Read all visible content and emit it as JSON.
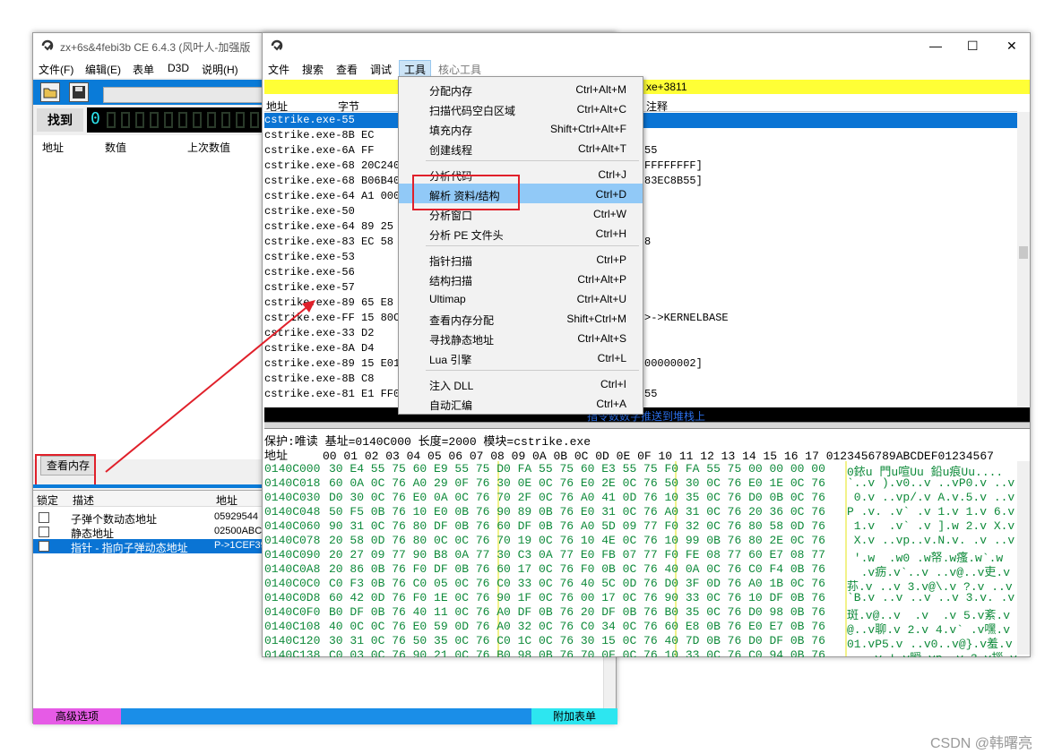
{
  "main_window": {
    "title": "zx+6s&4febi3b  CE 6.4.3 (风叶人-加强版",
    "menu": [
      "文件(F)",
      "编辑(E)",
      "表单",
      "D3D",
      "说明(H)"
    ],
    "found_label": "找到",
    "found_count": "0",
    "list_headers": [
      "地址",
      "数值",
      "上次数值"
    ],
    "view_memory_button": "查看内存",
    "cheat_table": {
      "headers": [
        "锁定",
        "描述",
        "地址"
      ],
      "rows": [
        {
          "desc": "子弹个数动态地址",
          "addr": "05929544"
        },
        {
          "desc": "静态地址",
          "addr": "02500ABC"
        },
        {
          "desc": "指针 - 指向子弹动态地址",
          "addr": "P->1CEF39"
        }
      ]
    },
    "advanced_options": "高级选项",
    "add_table": "附加表单"
  },
  "memory_viewer": {
    "menu": [
      "文件",
      "搜索",
      "查看",
      "调试",
      "工具",
      "核心工具"
    ],
    "active_menu": "工具",
    "yellow_bar_text": "xe+3811",
    "dis_headers": [
      "地址",
      "字节",
      "注释"
    ],
    "dis_rows": [
      {
        "addr": "cstrike.exe-55",
        "bytes": "",
        "comment": ""
      },
      {
        "addr": "cstrike.exe-8B",
        "bytes": "EC",
        "comment": ""
      },
      {
        "addr": "cstrike.exe-6A",
        "bytes": "FF",
        "comment": "55"
      },
      {
        "addr": "cstrike.exe-68",
        "bytes": "20C2400",
        "comment": "FFFFFFFF]"
      },
      {
        "addr": "cstrike.exe-68",
        "bytes": "B06B400",
        "comment": "83EC8B55]"
      },
      {
        "addr": "cstrike.exe-64",
        "bytes": "A1 0000",
        "comment": ""
      },
      {
        "addr": "cstrike.exe-50",
        "bytes": "",
        "comment": ""
      },
      {
        "addr": "cstrike.exe-64",
        "bytes": "89 25 0",
        "comment": ""
      },
      {
        "addr": "cstrike.exe-83",
        "bytes": "EC 58",
        "comment": "8"
      },
      {
        "addr": "cstrike.exe-53",
        "bytes": "",
        "comment": ""
      },
      {
        "addr": "cstrike.exe-56",
        "bytes": "",
        "comment": ""
      },
      {
        "addr": "cstrike.exe-57",
        "bytes": "",
        "comment": ""
      },
      {
        "addr": "cstrike.exe-89",
        "bytes": "65 E8",
        "comment": ""
      },
      {
        "addr": "cstrike.exe-FF",
        "bytes": "15 80C0",
        "comment": ">->KERNELBASE"
      },
      {
        "addr": "cstrike.exe-33",
        "bytes": "D2",
        "comment": ""
      },
      {
        "addr": "cstrike.exe-8A",
        "bytes": "D4",
        "comment": ""
      },
      {
        "addr": "cstrike.exe-89",
        "bytes": "15 E01E",
        "comment": "00000002]"
      },
      {
        "addr": "cstrike.exe-8B",
        "bytes": "C8",
        "comment": ""
      },
      {
        "addr": "cstrike.exe-81",
        "bytes": "E1 FF00",
        "comment": "55"
      }
    ],
    "black_bar_text": "指令数数字推送到堆栈上",
    "protection_line": "保护:唯读  基址=0140C000 长度=2000 模块=cstrike.exe",
    "hex_header": "地址     00 01 02 03 04 05 06 07 08 09 0A 0B 0C 0D 0E 0F 10 11 12 13 14 15 16 17 0123456789ABCDEF01234567",
    "hex_rows": [
      {
        "addr": "0140C000",
        "bytes": "30 E4 55 75 60 E9 55 75 D0 FA 55 75 60 E3 55 75 F0 FA 55 75 00 00 00 00",
        "ascii": "0銥u 門u喧Uu 鉛u痕Uu...."
      },
      {
        "addr": "0140C018",
        "bytes": "60 0A 0C 76 A0 29 0F 76 30 0E 0C 76 E0 2E 0C 76 50 30 0C 76 E0 1E 0C 76",
        "ascii": "`..v ).v0..v ..vP0.v ..v"
      },
      {
        "addr": "0140C030",
        "bytes": "D0 30 0C 76 E0 0A 0C 76 70 2F 0C 76 A0 41 0D 76 10 35 0C 76 D0 0B 0C 76",
        "ascii": " 0.v ..vp/.v A.v.5.v ..v"
      },
      {
        "addr": "0140C048",
        "bytes": "50 F5 0B 76 10 E0 0B 76 90 89 0B 76 E0 31 0C 76 A0 31 0C 76 20 36 0C 76",
        "ascii": "P .v. .v` .v 1.v 1.v 6.v"
      },
      {
        "addr": "0140C060",
        "bytes": "90 31 0C 76 80 DF 0B 76 60 DF 0B 76 A0 5D 09 77 F0 32 0C 76 80 58 0D 76",
        "ascii": " 1.v  .v` .v ].w 2.v X.v"
      },
      {
        "addr": "0140C078",
        "bytes": "20 58 0D 76 80 0C 0C 76 70 19 0C 76 10 4E 0C 76 10 99 0B 76 80 2E 0C 76",
        "ascii": " X.v ..vp..v.N.v. .v ..v"
      },
      {
        "addr": "0140C090",
        "bytes": "20 27 09 77 90 B8 0A 77 30 C3 0A 77 E0 FB 07 77 F0 FE 08 77 60 E7 08 77",
        "ascii": " '.w  .w0 .w帑.w瘙.w`.w"
      },
      {
        "addr": "0140C0A8",
        "bytes": "20 86 0B 76 F0 DF 0B 76 60 17 0C 76 F0 0B 0C 76 40 0A 0C 76 C0 F4 0B 76",
        "ascii": "  .v疬.v`..v ..v@..v吏.v"
      },
      {
        "addr": "0140C0C0",
        "bytes": "C0 F3 0B 76 C0 05 0C 76 C0 33 0C 76 40 5C 0D 76 D0 3F 0D 76 A0 1B 0C 76",
        "ascii": "荪.v ..v 3.v@\\.v ?.v ..v"
      },
      {
        "addr": "0140C0D8",
        "bytes": "60 42 0D 76 F0 1E 0C 76 90 1F 0C 76 00 17 0C 76 90 33 0C 76 10 DF 0B 76",
        "ascii": "`B.v ..v ..v ..v 3.v. .v"
      },
      {
        "addr": "0140C0F0",
        "bytes": "B0 DF 0B 76 40 11 0C 76 A0 DF 0B 76 20 DF 0B 76 B0 35 0C 76 D0 98 0B 76",
        "ascii": "斑.v@..v  .v  .v 5.v紊.v"
      },
      {
        "addr": "0140C108",
        "bytes": "40 0C 0C 76 E0 59 0D 76 A0 32 0C 76 C0 34 0C 76 60 E8 0B 76 E0 E7 0B 76",
        "ascii": "@..v聊.v 2.v 4.v` .v嘿.v"
      },
      {
        "addr": "0140C120",
        "bytes": "30 31 0C 76 50 35 0C 76 C0 1C 0C 76 30 15 0C 76 40 7D 0B 76 D0 DF 0B 76",
        "ascii": "01.vP5.v ..v0..v@}.v羞.v"
      },
      {
        "addr": "0140C138",
        "bytes": "C0 03 0C 76 90 21 0C 76 B0 98 0B 76 70 0F 0C 76 10 33 0C 76 C0 94 0B 76",
        "ascii": "  ..v !.v瞬.vp..v 3.v拶.v"
      }
    ]
  },
  "tools_menu": {
    "items": [
      {
        "label": "分配内存",
        "shortcut": "Ctrl+Alt+M"
      },
      {
        "label": "扫描代码空白区域",
        "shortcut": "Ctrl+Alt+C"
      },
      {
        "label": "填充内存",
        "shortcut": "Shift+Ctrl+Alt+F"
      },
      {
        "label": "创建线程",
        "shortcut": "Ctrl+Alt+T"
      },
      {
        "label": "分析代码",
        "shortcut": "Ctrl+J"
      },
      {
        "label": "解析 资料/结构",
        "shortcut": "Ctrl+D"
      },
      {
        "label": "分析窗口",
        "shortcut": "Ctrl+W"
      },
      {
        "label": "分析 PE 文件头",
        "shortcut": "Ctrl+H"
      },
      {
        "label": "指针扫描",
        "shortcut": "Ctrl+P"
      },
      {
        "label": "结构扫描",
        "shortcut": "Ctrl+Alt+P"
      },
      {
        "label": "Ultimap",
        "shortcut": "Ctrl+Alt+U"
      },
      {
        "label": "查看内存分配",
        "shortcut": "Shift+Ctrl+M"
      },
      {
        "label": "寻找静态地址",
        "shortcut": "Ctrl+Alt+S"
      },
      {
        "label": "Lua 引擎",
        "shortcut": "Ctrl+L"
      },
      {
        "label": "注入 DLL",
        "shortcut": "Ctrl+I"
      },
      {
        "label": "自动汇编",
        "shortcut": "Ctrl+A"
      }
    ]
  },
  "watermark": "CSDN @韩曙亮",
  "colors": {
    "accent_blue": "#0a7bd8",
    "highlight_red": "#e0202a",
    "selected_row": "#0a74d4",
    "yellow_bar": "#ffff36",
    "hex_green": "#0e8a3a"
  }
}
